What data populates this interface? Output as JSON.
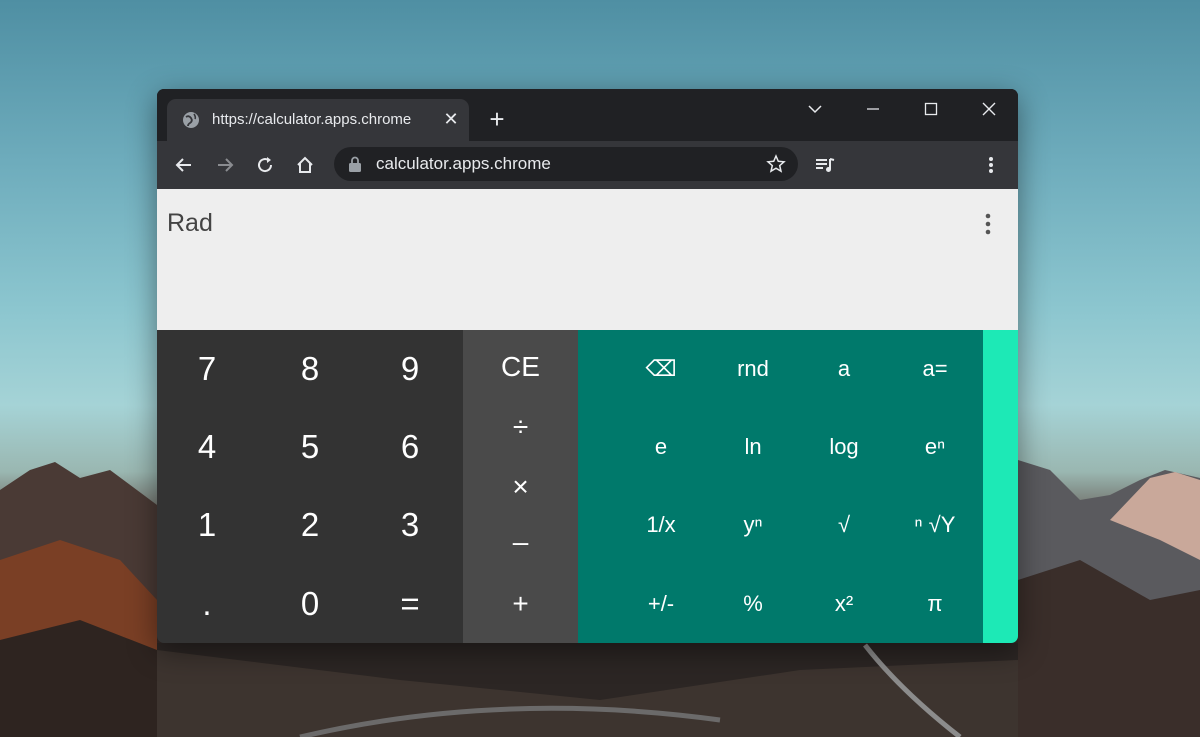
{
  "browser": {
    "tab_title": "https://calculator.apps.chrome",
    "tab_close": "✕",
    "new_tab": "+",
    "url": "calculator.apps.chrome",
    "colors": {
      "frame": "#202124",
      "toolbar": "#35363a",
      "text": "#e8eaed"
    }
  },
  "calculator": {
    "mode": "Rad",
    "display_value": "",
    "number_keys": [
      "7",
      "8",
      "9",
      "4",
      "5",
      "6",
      "1",
      "2",
      "3",
      ".",
      "0",
      "="
    ],
    "operator_keys": [
      "CE",
      "÷",
      "×",
      "–",
      "+"
    ],
    "scientific_keys": [
      "⌫",
      "rnd",
      "a",
      "a=",
      "e",
      "ln",
      "log",
      "eⁿ",
      "1/x",
      "yⁿ",
      "√",
      "ⁿ √Y",
      "+/-",
      "%",
      "x²",
      "π"
    ],
    "colors": {
      "display_bg": "#eeeeee",
      "numpad_bg": "#333333",
      "operator_bg": "#4a4a4a",
      "scientific_bg": "#00796b",
      "drawer_accent": "#1de9b6"
    }
  }
}
